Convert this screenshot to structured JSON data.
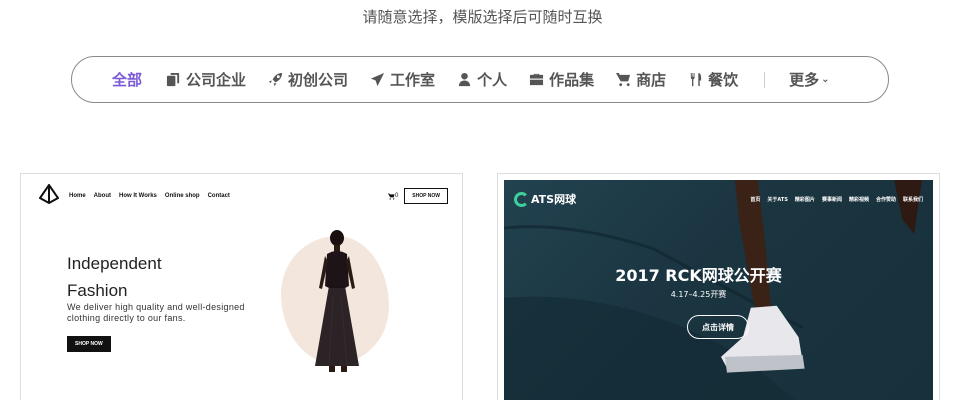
{
  "subtitle": "请随意选择，模版选择后可随时互换",
  "filters": [
    {
      "label": "全部",
      "icon": "none",
      "active": true
    },
    {
      "label": "公司企业",
      "icon": "copy-icon"
    },
    {
      "label": "初创公司",
      "icon": "rocket-icon"
    },
    {
      "label": "工作室",
      "icon": "send-icon"
    },
    {
      "label": "个人",
      "icon": "user-icon"
    },
    {
      "label": "作品集",
      "icon": "briefcase-icon"
    },
    {
      "label": "商店",
      "icon": "cart-icon"
    },
    {
      "label": "餐饮",
      "icon": "cutlery-icon"
    }
  ],
  "more_label": "更多",
  "more_chevron": "⌄",
  "accent_color": "#7b5ad6",
  "template_fashion": {
    "nav_links": [
      "Home",
      "About",
      "How It Works",
      "Online shop",
      "Contact"
    ],
    "cart_count": "0",
    "shop_top_label": "SHOP NOW",
    "hero_title": "Independent Fashion",
    "hero_text": "We deliver high quality and well-designed clothing directly to our fans.",
    "hero_button": "SHOP NOW"
  },
  "template_tennis": {
    "logo_text": "ATS网球",
    "nav_links": [
      "首页",
      "关于ATS",
      "精彩图片",
      "赛事新闻",
      "精彩视频",
      "合作赞助",
      "联系我们"
    ],
    "headline": "2017 RCK网球公开赛",
    "dates": "4.17–4.25开赛",
    "button": "点击详情",
    "brand_color": "#3fcf9a"
  }
}
